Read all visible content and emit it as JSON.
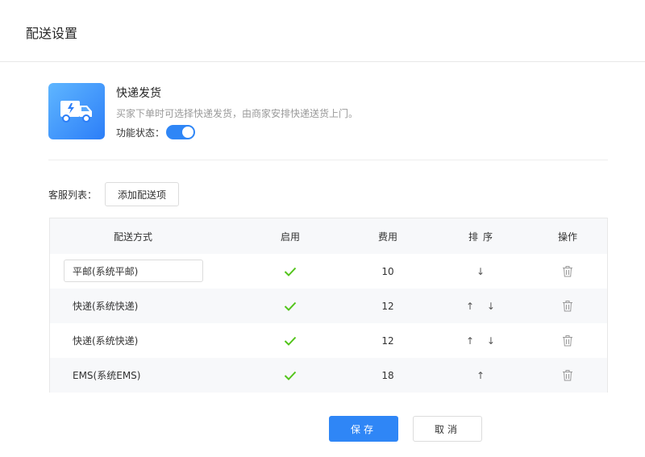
{
  "header": {
    "title": "配送设置"
  },
  "feature": {
    "icon": "delivery-truck-icon",
    "title": "快递发货",
    "description": "买家下单时可选择快递发货，由商家安排快递送货上门。",
    "status_label": "功能状态：",
    "enabled": true
  },
  "list": {
    "label": "客服列表：",
    "add_button": "添加配送项"
  },
  "table": {
    "columns": [
      "配送方式",
      "启用",
      "费用",
      "排序",
      "操作"
    ],
    "rows": [
      {
        "method": "平邮(系统平邮)",
        "editing": true,
        "enabled": true,
        "fee": "10",
        "sort": "↓",
        "op_icon": "trash-icon"
      },
      {
        "method": "快递(系统快递)",
        "editing": false,
        "enabled": true,
        "fee": "12",
        "sort": "↑ ↓",
        "op_icon": "trash-icon"
      },
      {
        "method": "快递(系统快递)",
        "editing": false,
        "enabled": true,
        "fee": "12",
        "sort": "↑ ↓",
        "op_icon": "trash-icon"
      },
      {
        "method": "EMS(系统EMS)",
        "editing": false,
        "enabled": true,
        "fee": "18",
        "sort": "↑",
        "op_icon": "trash-icon"
      }
    ]
  },
  "footer": {
    "save": "保存",
    "cancel": "取消"
  },
  "colors": {
    "accent": "#2f86f6",
    "check": "#52c41a",
    "header_bg": "#f7f8fa"
  }
}
